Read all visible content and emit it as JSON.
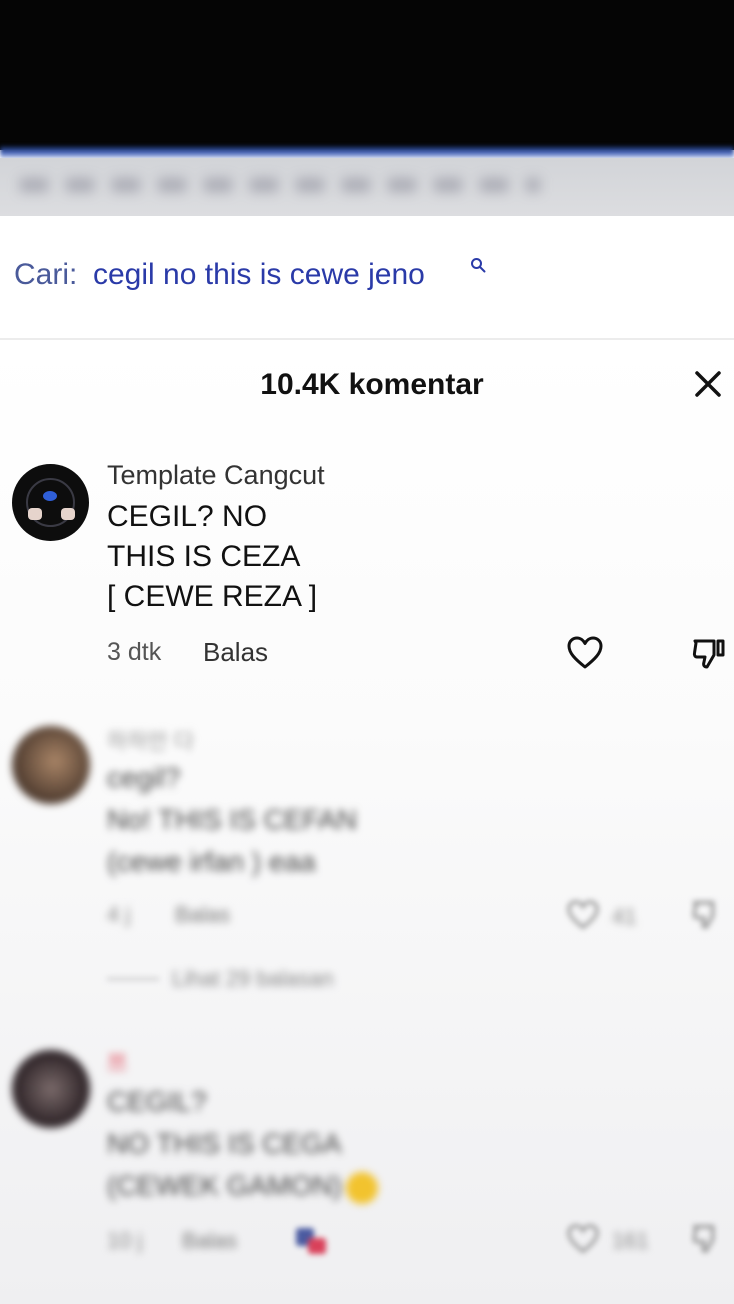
{
  "search": {
    "prefix": "Cari:",
    "query": "cegil no this is cewe jeno"
  },
  "comments_header": {
    "count_label": "10.4K komentar"
  },
  "comments": [
    {
      "username": "Template Cangcut",
      "lines": [
        "CEGIL? NO",
        "THIS IS CEZA",
        "[ CEWE REZA ]"
      ],
      "time": "3 dtk",
      "reply_label": "Balas"
    },
    {
      "username": "하하만 다",
      "lines": [
        "cegil?",
        "No! THIS IS CEFAN",
        "(cewe irfan ) eaa"
      ],
      "time": "4 j",
      "reply_label": "Balas",
      "likes": "41",
      "view_replies": "Lihat 29 balasan"
    },
    {
      "username": "쯔",
      "lines": [
        "CEGIL?",
        "NO THIS IS CEGA",
        "(CEWEK GAMON)"
      ],
      "time": "10 j",
      "reply_label": "Balas",
      "likes": "161"
    }
  ],
  "icons": {
    "search": "search-icon",
    "close": "close-icon",
    "like": "heart-icon",
    "dislike": "dislike-icon"
  },
  "colors": {
    "search_text": "#2a3aa8",
    "background": "#ffffff",
    "top": "#050505"
  }
}
